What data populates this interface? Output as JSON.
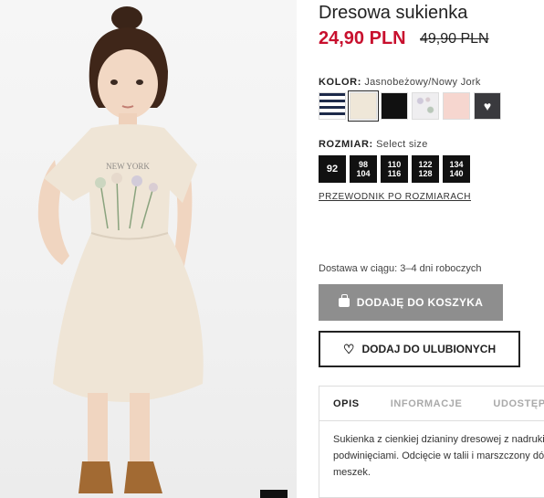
{
  "product": {
    "title": "Dresowa sukienka",
    "price": "24,90 PLN",
    "old_price": "49,90 PLN"
  },
  "color": {
    "label": "KOLOR:",
    "value": "Jasnobeżowy/Nowy Jork",
    "swatches": [
      "navy-white-stripes",
      "light-beige",
      "black",
      "floral-print",
      "light-pink",
      "dark-grey-heart"
    ]
  },
  "size": {
    "label": "ROZMIAR:",
    "value": "Select size",
    "options": [
      {
        "a": "92",
        "b": ""
      },
      {
        "a": "98",
        "b": "104"
      },
      {
        "a": "110",
        "b": "116"
      },
      {
        "a": "122",
        "b": "128"
      },
      {
        "a": "134",
        "b": "140"
      }
    ],
    "guide": "PRZEWODNIK PO ROZMIARACH"
  },
  "delivery": "Dostawa w ciągu: 3–4 dni roboczych",
  "buttons": {
    "add_to_cart": "DODAJĘ DO KOSZYKA",
    "add_to_favorites": "DODAJ DO ULUBIONYCH"
  },
  "tabs": {
    "items": [
      "OPIS",
      "INFORMACJE",
      "UDOSTĘPNIJ"
    ],
    "content_line1": "Sukienka z cienkiej dzianiny dresowej z nadrukiem",
    "content_line2": "podwinięciami. Odcięcie w talii i marszczony dół",
    "content_line3": "meszek."
  },
  "photo": {
    "print_text": "NEW YORK"
  },
  "colors": {
    "accent_red": "#c8102e",
    "cart_button": "#8e8e8e"
  }
}
